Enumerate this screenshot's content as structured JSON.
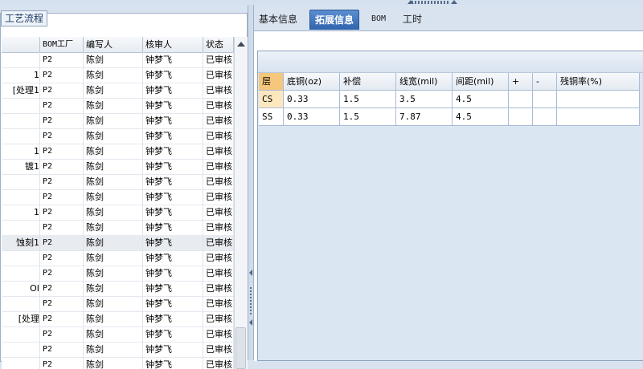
{
  "left": {
    "group_title": "工艺流程",
    "columns": [
      "",
      "BOM工厂",
      "编写人",
      "核审人",
      "状态"
    ],
    "rows": [
      [
        "",
        "P2",
        "陈剑",
        "钟梦飞",
        "已审核"
      ],
      [
        "1",
        "P2",
        "陈剑",
        "钟梦飞",
        "已审核"
      ],
      [
        "[处理1",
        "P2",
        "陈剑",
        "钟梦飞",
        "已审核"
      ],
      [
        "",
        "P2",
        "陈剑",
        "钟梦飞",
        "已审核"
      ],
      [
        "",
        "P2",
        "陈剑",
        "钟梦飞",
        "已审核"
      ],
      [
        "",
        "P2",
        "陈剑",
        "钟梦飞",
        "已审核"
      ],
      [
        "1",
        "P2",
        "陈剑",
        "钟梦飞",
        "已审核"
      ],
      [
        "镀1",
        "P2",
        "陈剑",
        "钟梦飞",
        "已审核"
      ],
      [
        "",
        "P2",
        "陈剑",
        "钟梦飞",
        "已审核"
      ],
      [
        "",
        "P2",
        "陈剑",
        "钟梦飞",
        "已审核"
      ],
      [
        "1",
        "P2",
        "陈剑",
        "钟梦飞",
        "已审核"
      ],
      [
        "",
        "P2",
        "陈剑",
        "钟梦飞",
        "已审核"
      ],
      [
        "蚀刻1",
        "P2",
        "陈剑",
        "钟梦飞",
        "已审核"
      ],
      [
        "",
        "P2",
        "陈剑",
        "钟梦飞",
        "已审核"
      ],
      [
        "",
        "P2",
        "陈剑",
        "钟梦飞",
        "已审核"
      ],
      [
        "OI",
        "P2",
        "陈剑",
        "钟梦飞",
        "已审核"
      ],
      [
        "",
        "P2",
        "陈剑",
        "钟梦飞",
        "已审核"
      ],
      [
        "[处理",
        "P2",
        "陈剑",
        "钟梦飞",
        "已审核"
      ],
      [
        "",
        "P2",
        "陈剑",
        "钟梦飞",
        "已审核"
      ],
      [
        "",
        "P2",
        "陈剑",
        "钟梦飞",
        "已审核"
      ],
      [
        "",
        "P2",
        "陈剑",
        "钟梦飞",
        "已审核"
      ]
    ],
    "selected_row": 12
  },
  "tabs": [
    {
      "label": "基本信息",
      "active": false
    },
    {
      "label": "拓展信息",
      "active": true
    },
    {
      "label": "BOM",
      "active": false
    },
    {
      "label": "工时",
      "active": false
    }
  ],
  "right": {
    "columns": [
      "层",
      "底铜(oz)",
      "补偿",
      "线宽(mil)",
      "间距(mil)",
      "+",
      "-",
      "残铜率(%)"
    ],
    "rows": [
      [
        "CS",
        "0.33",
        "1.5",
        "3.5",
        "4.5",
        "",
        "",
        ""
      ],
      [
        "SS",
        "0.33",
        "1.5",
        "7.87",
        "4.5",
        "",
        "",
        ""
      ]
    ]
  },
  "colors": {
    "active_tab": "#3a6fba",
    "layer_header_highlight": "#f5c77c",
    "frame_bg": "#dbe6f3"
  }
}
